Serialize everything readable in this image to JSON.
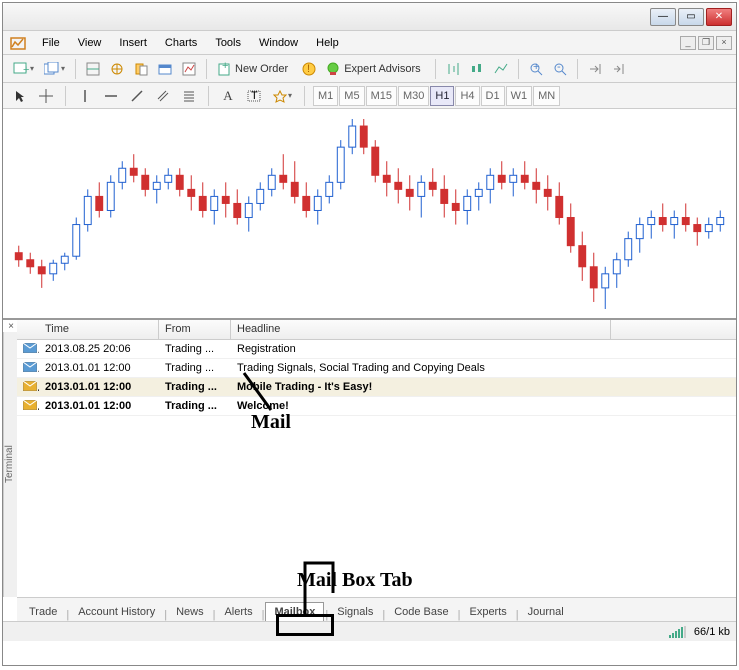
{
  "menu": {
    "file": "File",
    "view": "View",
    "insert": "Insert",
    "charts": "Charts",
    "tools": "Tools",
    "window": "Window",
    "help": "Help"
  },
  "toolbar": {
    "neworder": "New Order",
    "ea": "Expert Advisors"
  },
  "timeframes": [
    "M1",
    "M5",
    "M15",
    "M30",
    "H1",
    "H4",
    "D1",
    "W1",
    "MN"
  ],
  "active_tf": "H1",
  "mail": {
    "cols": {
      "time": "Time",
      "from": "From",
      "headline": "Headline"
    },
    "rows": [
      {
        "time": "2013.08.25 20:06",
        "from": "Trading ...",
        "headline": "Registration",
        "unread": false,
        "open": true
      },
      {
        "time": "2013.01.01 12:00",
        "from": "Trading ...",
        "headline": "Trading Signals, Social Trading and Copying Deals",
        "unread": false,
        "open": true
      },
      {
        "time": "2013.01.01 12:00",
        "from": "Trading ...",
        "headline": "Mobile Trading - It's Easy!",
        "unread": true,
        "open": false,
        "sel": true
      },
      {
        "time": "2013.01.01 12:00",
        "from": "Trading ...",
        "headline": "Welcome!",
        "unread": true,
        "open": false
      }
    ]
  },
  "terminal_label": "Terminal",
  "tabs": [
    "Trade",
    "Account History",
    "News",
    "Alerts",
    "Mailbox",
    "Signals",
    "Code Base",
    "Experts",
    "Journal"
  ],
  "active_tab": "Mailbox",
  "status": {
    "net": "66/1 kb"
  },
  "annotations": {
    "mail": "Mail",
    "mailboxtab": "Mail Box Tab"
  },
  "chart_data": {
    "type": "candlestick",
    "note": "approximate OHLC candlestick values read from pixel positions",
    "series": [
      {
        "o": 140,
        "h": 142,
        "l": 136,
        "c": 138
      },
      {
        "o": 138,
        "h": 140,
        "l": 134,
        "c": 136
      },
      {
        "o": 136,
        "h": 138,
        "l": 130,
        "c": 134
      },
      {
        "o": 134,
        "h": 138,
        "l": 132,
        "c": 137
      },
      {
        "o": 137,
        "h": 140,
        "l": 135,
        "c": 139
      },
      {
        "o": 139,
        "h": 150,
        "l": 138,
        "c": 148
      },
      {
        "o": 148,
        "h": 158,
        "l": 146,
        "c": 156
      },
      {
        "o": 156,
        "h": 160,
        "l": 150,
        "c": 152
      },
      {
        "o": 152,
        "h": 162,
        "l": 150,
        "c": 160
      },
      {
        "o": 160,
        "h": 166,
        "l": 158,
        "c": 164
      },
      {
        "o": 164,
        "h": 168,
        "l": 160,
        "c": 162
      },
      {
        "o": 162,
        "h": 164,
        "l": 156,
        "c": 158
      },
      {
        "o": 158,
        "h": 162,
        "l": 154,
        "c": 160
      },
      {
        "o": 160,
        "h": 164,
        "l": 158,
        "c": 162
      },
      {
        "o": 162,
        "h": 164,
        "l": 156,
        "c": 158
      },
      {
        "o": 158,
        "h": 162,
        "l": 152,
        "c": 156
      },
      {
        "o": 156,
        "h": 160,
        "l": 150,
        "c": 152
      },
      {
        "o": 152,
        "h": 158,
        "l": 148,
        "c": 156
      },
      {
        "o": 156,
        "h": 160,
        "l": 150,
        "c": 154
      },
      {
        "o": 154,
        "h": 158,
        "l": 148,
        "c": 150
      },
      {
        "o": 150,
        "h": 156,
        "l": 146,
        "c": 154
      },
      {
        "o": 154,
        "h": 160,
        "l": 152,
        "c": 158
      },
      {
        "o": 158,
        "h": 164,
        "l": 156,
        "c": 162
      },
      {
        "o": 162,
        "h": 168,
        "l": 158,
        "c": 160
      },
      {
        "o": 160,
        "h": 166,
        "l": 154,
        "c": 156
      },
      {
        "o": 156,
        "h": 160,
        "l": 150,
        "c": 152
      },
      {
        "o": 152,
        "h": 158,
        "l": 148,
        "c": 156
      },
      {
        "o": 156,
        "h": 162,
        "l": 154,
        "c": 160
      },
      {
        "o": 160,
        "h": 172,
        "l": 158,
        "c": 170
      },
      {
        "o": 170,
        "h": 178,
        "l": 168,
        "c": 176
      },
      {
        "o": 176,
        "h": 178,
        "l": 168,
        "c": 170
      },
      {
        "o": 170,
        "h": 172,
        "l": 160,
        "c": 162
      },
      {
        "o": 162,
        "h": 166,
        "l": 156,
        "c": 160
      },
      {
        "o": 160,
        "h": 164,
        "l": 154,
        "c": 158
      },
      {
        "o": 158,
        "h": 162,
        "l": 152,
        "c": 156
      },
      {
        "o": 156,
        "h": 162,
        "l": 150,
        "c": 160
      },
      {
        "o": 160,
        "h": 164,
        "l": 156,
        "c": 158
      },
      {
        "o": 158,
        "h": 162,
        "l": 150,
        "c": 154
      },
      {
        "o": 154,
        "h": 158,
        "l": 148,
        "c": 152
      },
      {
        "o": 152,
        "h": 158,
        "l": 148,
        "c": 156
      },
      {
        "o": 156,
        "h": 160,
        "l": 152,
        "c": 158
      },
      {
        "o": 158,
        "h": 164,
        "l": 154,
        "c": 162
      },
      {
        "o": 162,
        "h": 166,
        "l": 158,
        "c": 160
      },
      {
        "o": 160,
        "h": 164,
        "l": 156,
        "c": 162
      },
      {
        "o": 162,
        "h": 166,
        "l": 158,
        "c": 160
      },
      {
        "o": 160,
        "h": 164,
        "l": 154,
        "c": 158
      },
      {
        "o": 158,
        "h": 162,
        "l": 152,
        "c": 156
      },
      {
        "o": 156,
        "h": 160,
        "l": 148,
        "c": 150
      },
      {
        "o": 150,
        "h": 154,
        "l": 140,
        "c": 142
      },
      {
        "o": 142,
        "h": 146,
        "l": 132,
        "c": 136
      },
      {
        "o": 136,
        "h": 140,
        "l": 126,
        "c": 130
      },
      {
        "o": 130,
        "h": 136,
        "l": 124,
        "c": 134
      },
      {
        "o": 134,
        "h": 140,
        "l": 130,
        "c": 138
      },
      {
        "o": 138,
        "h": 146,
        "l": 136,
        "c": 144
      },
      {
        "o": 144,
        "h": 150,
        "l": 140,
        "c": 148
      },
      {
        "o": 148,
        "h": 152,
        "l": 144,
        "c": 150
      },
      {
        "o": 150,
        "h": 154,
        "l": 146,
        "c": 148
      },
      {
        "o": 148,
        "h": 152,
        "l": 144,
        "c": 150
      },
      {
        "o": 150,
        "h": 154,
        "l": 146,
        "c": 148
      },
      {
        "o": 148,
        "h": 150,
        "l": 142,
        "c": 146
      },
      {
        "o": 146,
        "h": 150,
        "l": 144,
        "c": 148
      },
      {
        "o": 148,
        "h": 152,
        "l": 146,
        "c": 150
      }
    ]
  }
}
